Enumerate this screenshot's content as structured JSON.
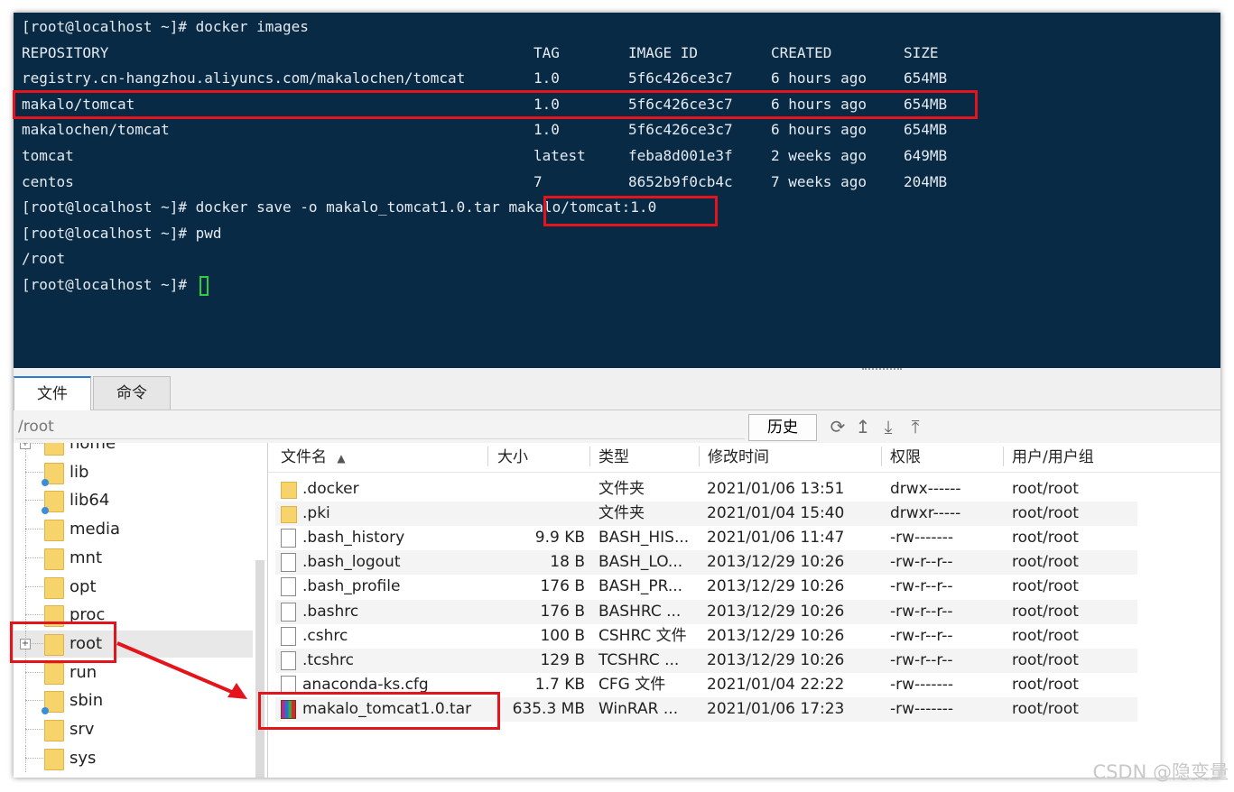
{
  "terminal": {
    "lines": [
      "[root@localhost ~]# docker images",
      "",
      "",
      "",
      "",
      "",
      "",
      "[root@localhost ~]# docker save -o makalo_tomcat1.0.tar makalo/tomcat:1.0",
      "[root@localhost ~]# pwd",
      "/root",
      "[root@localhost ~]# "
    ],
    "images_header": [
      "REPOSITORY",
      "TAG",
      "IMAGE ID",
      "CREATED",
      "SIZE"
    ],
    "images": [
      [
        "registry.cn-hangzhou.aliyuncs.com/makalochen/tomcat",
        "1.0",
        "5f6c426ce3c7",
        "6 hours ago",
        "654MB"
      ],
      [
        "makalo/tomcat",
        "1.0",
        "5f6c426ce3c7",
        "6 hours ago",
        "654MB"
      ],
      [
        "makalochen/tomcat",
        "1.0",
        "5f6c426ce3c7",
        "6 hours ago",
        "654MB"
      ],
      [
        "tomcat",
        "latest",
        "feba8d001e3f",
        "2 weeks ago",
        "649MB"
      ],
      [
        "centos",
        "7",
        "8652b9f0cb4c",
        "7 weeks ago",
        "204MB"
      ]
    ]
  },
  "tabs": [
    {
      "label": "文件",
      "active": true
    },
    {
      "label": "命令",
      "active": false
    }
  ],
  "pathbar": {
    "path": "/root",
    "history_label": "历史",
    "icons": [
      "refresh-icon",
      "up-icon",
      "download-icon",
      "upload-icon"
    ]
  },
  "tree": {
    "items": [
      {
        "label": "home",
        "link": false,
        "expandable": true,
        "selected": false
      },
      {
        "label": "lib",
        "link": true,
        "expandable": false,
        "selected": false
      },
      {
        "label": "lib64",
        "link": true,
        "expandable": false,
        "selected": false
      },
      {
        "label": "media",
        "link": false,
        "expandable": false,
        "selected": false
      },
      {
        "label": "mnt",
        "link": false,
        "expandable": false,
        "selected": false
      },
      {
        "label": "opt",
        "link": false,
        "expandable": false,
        "selected": false
      },
      {
        "label": "proc",
        "link": false,
        "expandable": false,
        "selected": false
      },
      {
        "label": "root",
        "link": false,
        "expandable": true,
        "selected": true
      },
      {
        "label": "run",
        "link": false,
        "expandable": false,
        "selected": false
      },
      {
        "label": "sbin",
        "link": true,
        "expandable": false,
        "selected": false
      },
      {
        "label": "srv",
        "link": false,
        "expandable": false,
        "selected": false
      },
      {
        "label": "sys",
        "link": false,
        "expandable": false,
        "selected": false
      }
    ]
  },
  "files": {
    "columns": [
      "文件名",
      "大小",
      "类型",
      "修改时间",
      "权限",
      "用户/用户组"
    ],
    "sort_indicator": "▲",
    "rows": [
      {
        "icon": "folder",
        "name": ".docker",
        "size": "",
        "type": "文件夹",
        "mtime": "2021/01/06 13:51",
        "perm": "drwx------",
        "owner": "root/root"
      },
      {
        "icon": "folder",
        "name": ".pki",
        "size": "",
        "type": "文件夹",
        "mtime": "2021/01/04 15:40",
        "perm": "drwxr-----",
        "owner": "root/root"
      },
      {
        "icon": "doc",
        "name": ".bash_history",
        "size": "9.9 KB",
        "type": "BASH_HIS...",
        "mtime": "2021/01/06 11:47",
        "perm": "-rw-------",
        "owner": "root/root"
      },
      {
        "icon": "doc",
        "name": ".bash_logout",
        "size": "18 B",
        "type": "BASH_LO...",
        "mtime": "2013/12/29 10:26",
        "perm": "-rw-r--r--",
        "owner": "root/root"
      },
      {
        "icon": "doc",
        "name": ".bash_profile",
        "size": "176 B",
        "type": "BASH_PR...",
        "mtime": "2013/12/29 10:26",
        "perm": "-rw-r--r--",
        "owner": "root/root"
      },
      {
        "icon": "doc",
        "name": ".bashrc",
        "size": "176 B",
        "type": "BASHRC ...",
        "mtime": "2013/12/29 10:26",
        "perm": "-rw-r--r--",
        "owner": "root/root"
      },
      {
        "icon": "doc",
        "name": ".cshrc",
        "size": "100 B",
        "type": "CSHRC 文件",
        "mtime": "2013/12/29 10:26",
        "perm": "-rw-r--r--",
        "owner": "root/root"
      },
      {
        "icon": "doc",
        "name": ".tcshrc",
        "size": "129 B",
        "type": "TCSHRC ...",
        "mtime": "2013/12/29 10:26",
        "perm": "-rw-r--r--",
        "owner": "root/root"
      },
      {
        "icon": "doc",
        "name": "anaconda-ks.cfg",
        "size": "1.7 KB",
        "type": "CFG 文件",
        "mtime": "2021/01/04 22:22",
        "perm": "-rw-------",
        "owner": "root/root"
      },
      {
        "icon": "rar",
        "name": "makalo_tomcat1.0.tar",
        "size": "635.3 MB",
        "type": "WinRAR ...",
        "mtime": "2021/01/06 17:23",
        "perm": "-rw-------",
        "owner": "root/root"
      }
    ]
  },
  "highlight_color": "#e3141c",
  "terminal_bg": "#082a45",
  "watermark": "CSDN @隐变量"
}
